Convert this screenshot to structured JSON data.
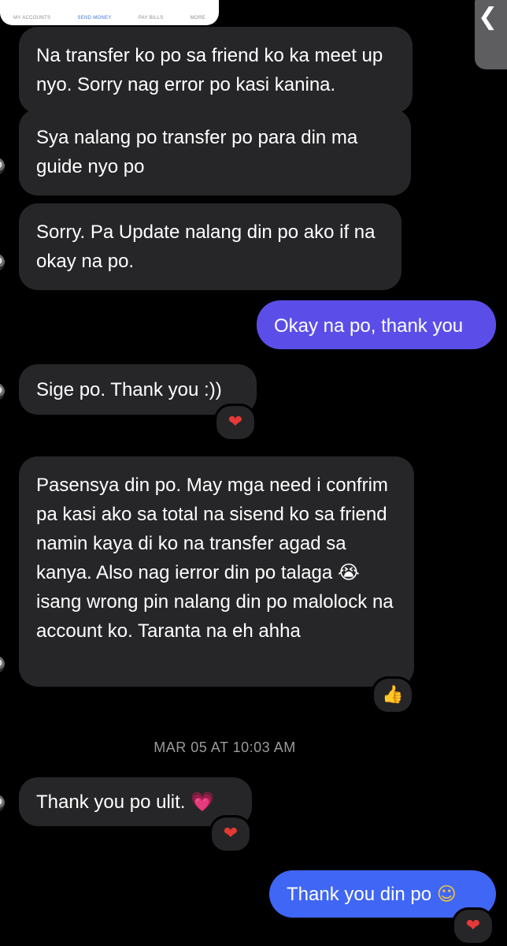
{
  "shared_card": {
    "nav": [
      "MY ACCOUNTS",
      "SEND MONEY",
      "PAY BILLS",
      "MORE"
    ]
  },
  "back_button": {
    "glyph": "❮"
  },
  "messages": [
    {
      "side": "incoming",
      "text": "Na transfer ko po sa friend ko ka meet up nyo. Sorry nag error po kasi kanina."
    },
    {
      "side": "incoming",
      "text": "Sya nalang po transfer po para din ma guide nyo po"
    },
    {
      "side": "incoming",
      "text": "Sorry. Pa Update nalang din po ako if na okay na po."
    },
    {
      "side": "outgoing",
      "text": "Okay na po, thank you"
    },
    {
      "side": "incoming",
      "text": "Sige po. Thank you :))",
      "reaction": "❤"
    },
    {
      "side": "incoming",
      "text_main": "Pasensya din po. May mga need i confrim pa kasi ako sa total na sisend ko sa friend namin kaya di ko na transfer agad sa kanya. Also nag ierror din po talaga",
      "emoji": "😭",
      "text_after": "isang wrong pin nalang din po malolock na account ko. Taranta na eh ahha",
      "reaction": "👍"
    },
    {
      "side": "incoming",
      "text_main": "Thank you po ulit.",
      "emoji": "💗",
      "reaction": "❤"
    },
    {
      "side": "outgoing",
      "text_main": "Thank you din po",
      "emoji": "☺",
      "reaction": "❤"
    }
  ],
  "timestamp": "MAR 05 AT 10:03 AM",
  "colors": {
    "background": "#000000",
    "incoming_bubble": "#262628",
    "outgoing_bubble_purple": "#5b4ee8",
    "outgoing_bubble_blue": "#3f66f4",
    "timestamp_text": "#9a9a9e",
    "heart": "#e53935"
  }
}
